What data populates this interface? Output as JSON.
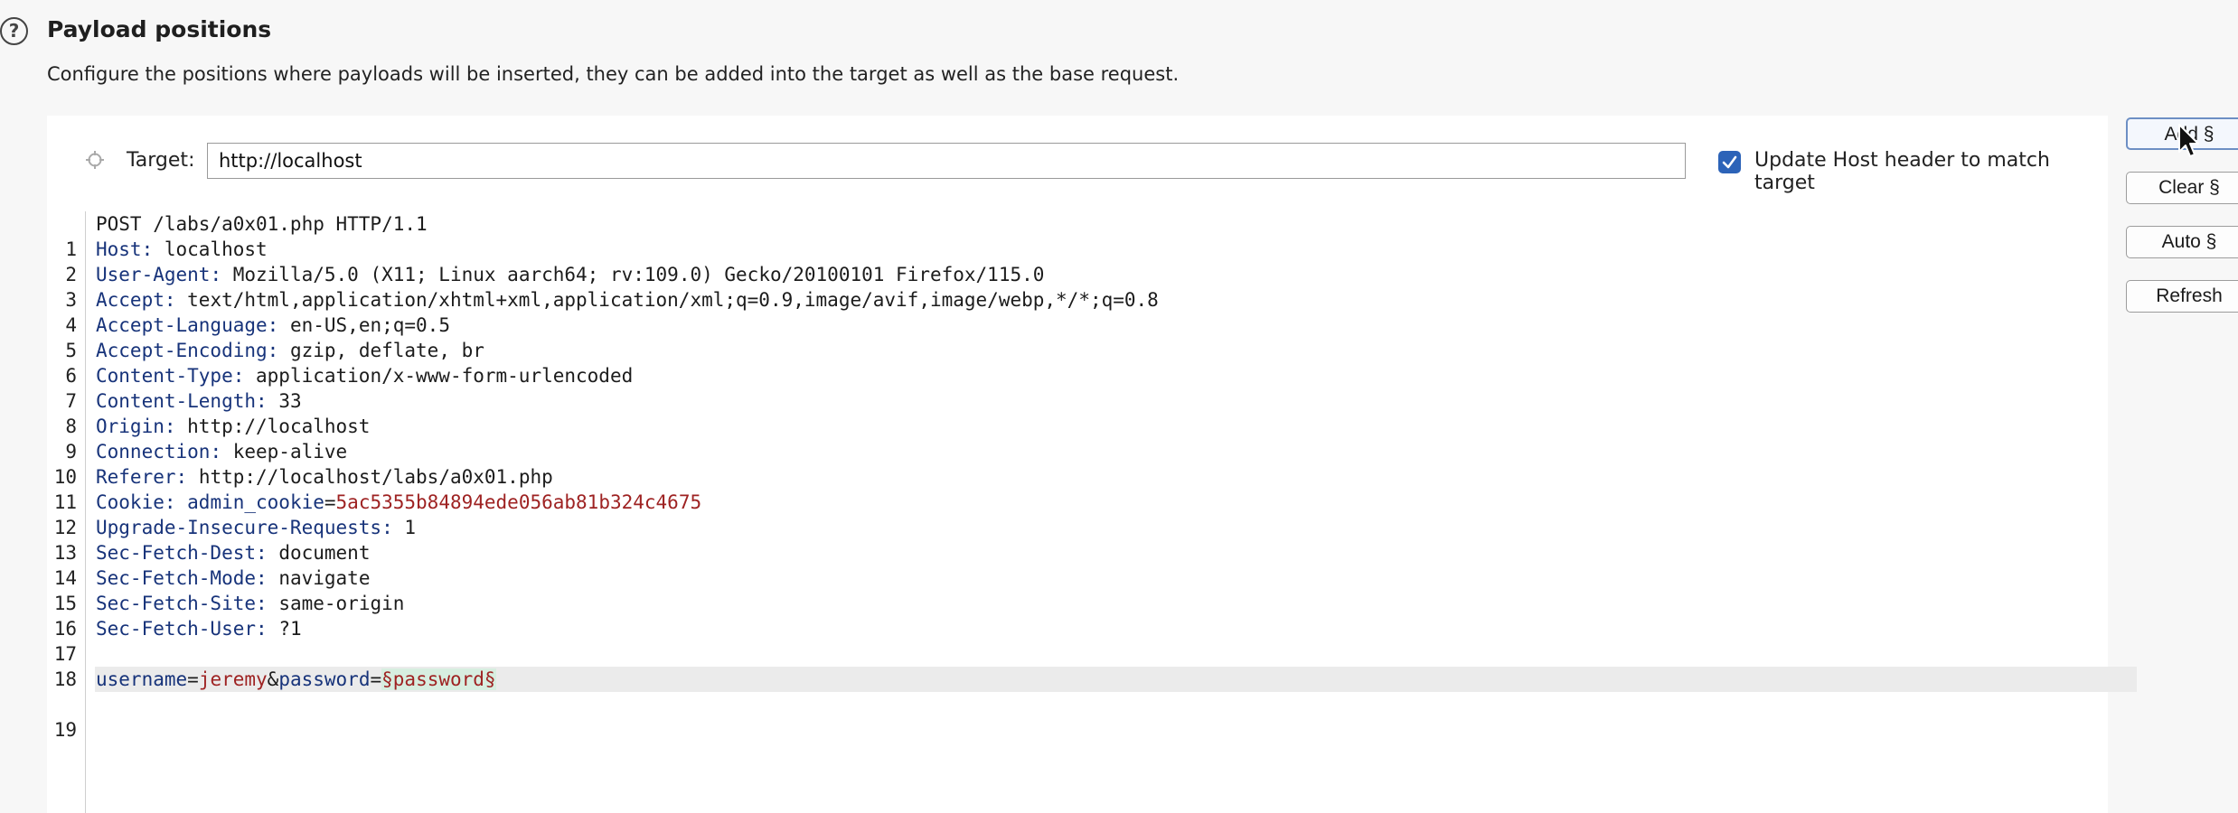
{
  "header": {
    "title": "Payload positions",
    "description": "Configure the positions where payloads will be inserted, they can be added into the target as well as the base request."
  },
  "target": {
    "label": "Target:",
    "value": "http://localhost",
    "update_host_label": "Update Host header to match target",
    "update_host_checked": true
  },
  "buttons": {
    "add": "Add §",
    "clear": "Clear §",
    "auto": "Auto §",
    "refresh": "Refresh"
  },
  "request": {
    "line_numbers": [
      "1",
      "2",
      "3",
      "4",
      "5",
      "6",
      "7",
      "8",
      "9",
      "10",
      "11",
      "12",
      "13",
      "14",
      "15",
      "16",
      "17",
      "18",
      "19"
    ],
    "request_line": "POST /labs/a0x01.php HTTP/1.1",
    "headers": [
      {
        "name": "Host",
        "value": " localhost"
      },
      {
        "name": "User-Agent",
        "value": " Mozilla/5.0 (X11; Linux aarch64; rv:109.0) Gecko/20100101 Firefox/115.0"
      },
      {
        "name": "Accept",
        "value": " text/html,application/xhtml+xml,application/xml;q=0.9,image/avif,image/webp,*/*;q=0.8"
      },
      {
        "name": "Accept-Language",
        "value": " en-US,en;q=0.5"
      },
      {
        "name": "Accept-Encoding",
        "value": " gzip, deflate, br"
      },
      {
        "name": "Content-Type",
        "value": " application/x-www-form-urlencoded"
      },
      {
        "name": "Content-Length",
        "value": " 33"
      },
      {
        "name": "Origin",
        "value": " http://localhost"
      },
      {
        "name": "Connection",
        "value": " keep-alive"
      },
      {
        "name": "Referer",
        "value": " http://localhost/labs/a0x01.php"
      }
    ],
    "cookie": {
      "name": "Cookie",
      "cookie_name": "admin_cookie",
      "cookie_value": "5ac5355b84894ede056ab81b324c4675"
    },
    "headers2": [
      {
        "name": "Upgrade-Insecure-Requests",
        "value": " 1"
      },
      {
        "name": "Sec-Fetch-Dest",
        "value": " document"
      },
      {
        "name": "Sec-Fetch-Mode",
        "value": " navigate"
      },
      {
        "name": "Sec-Fetch-Site",
        "value": " same-origin"
      },
      {
        "name": "Sec-Fetch-User",
        "value": " ?1"
      }
    ],
    "body": {
      "p1_name": "username",
      "p1_value": "jeremy",
      "p2_name": "password",
      "p2_payload": "§password§"
    }
  },
  "colors": {
    "header_name": "#17337a",
    "value_red": "#9e2222",
    "payload_bg": "#d7eee0",
    "checkbox": "#2c63b8"
  }
}
